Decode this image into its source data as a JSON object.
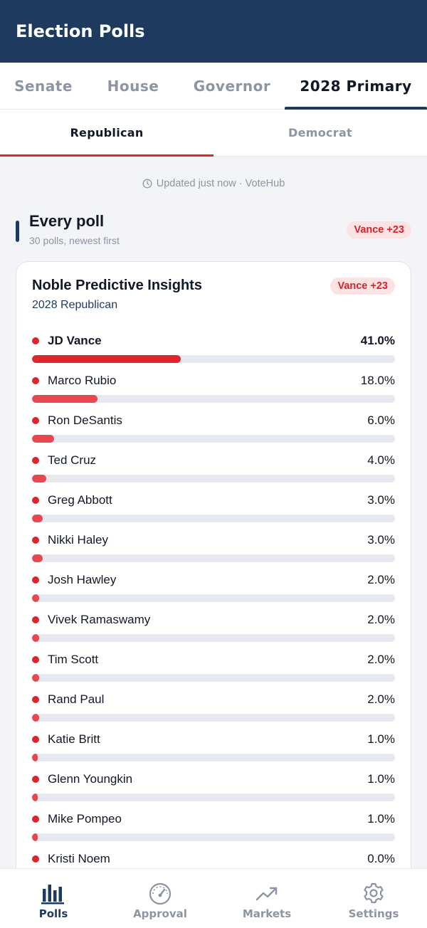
{
  "header": {
    "title": "Election Polls"
  },
  "race_tabs": [
    {
      "label": "Senate",
      "active": false
    },
    {
      "label": "House",
      "active": false
    },
    {
      "label": "Governor",
      "active": false
    },
    {
      "label": "2028 Primary",
      "active": true
    }
  ],
  "party_tabs": [
    {
      "label": "Republican",
      "active": true
    },
    {
      "label": "Democrat",
      "active": false
    }
  ],
  "updated": {
    "icon": "clock-icon",
    "text": "Updated just now · VoteHub"
  },
  "section": {
    "title": "Every poll",
    "subtitle": "30 polls, newest first",
    "badge": "Vance +23"
  },
  "poll": {
    "pollster": "Noble Predictive Insights",
    "race": "2028 Republican",
    "badge": "Vance +23",
    "candidates": [
      {
        "name": "JD Vance",
        "pct": "41.0%",
        "value": 41.0
      },
      {
        "name": "Marco Rubio",
        "pct": "18.0%",
        "value": 18.0
      },
      {
        "name": "Ron DeSantis",
        "pct": "6.0%",
        "value": 6.0
      },
      {
        "name": "Ted Cruz",
        "pct": "4.0%",
        "value": 4.0
      },
      {
        "name": "Greg Abbott",
        "pct": "3.0%",
        "value": 3.0
      },
      {
        "name": "Nikki Haley",
        "pct": "3.0%",
        "value": 3.0
      },
      {
        "name": "Josh Hawley",
        "pct": "2.0%",
        "value": 2.0
      },
      {
        "name": "Vivek Ramaswamy",
        "pct": "2.0%",
        "value": 2.0
      },
      {
        "name": "Tim Scott",
        "pct": "2.0%",
        "value": 2.0
      },
      {
        "name": "Rand Paul",
        "pct": "2.0%",
        "value": 2.0
      },
      {
        "name": "Katie Britt",
        "pct": "1.0%",
        "value": 1.0
      },
      {
        "name": "Glenn Youngkin",
        "pct": "1.0%",
        "value": 1.0
      },
      {
        "name": "Mike Pompeo",
        "pct": "1.0%",
        "value": 1.0
      },
      {
        "name": "Kristi Noem",
        "pct": "0.0%",
        "value": 0.0
      }
    ]
  },
  "bottom_nav": [
    {
      "label": "Polls",
      "icon": "bar-chart-icon",
      "active": true
    },
    {
      "label": "Approval",
      "icon": "gauge-icon",
      "active": false
    },
    {
      "label": "Markets",
      "icon": "trending-up-icon",
      "active": false
    },
    {
      "label": "Settings",
      "icon": "gear-icon",
      "active": false
    }
  ],
  "colors": {
    "navy": "#1e3a5f",
    "red": "#e0242b",
    "muted": "#8b95a3"
  }
}
